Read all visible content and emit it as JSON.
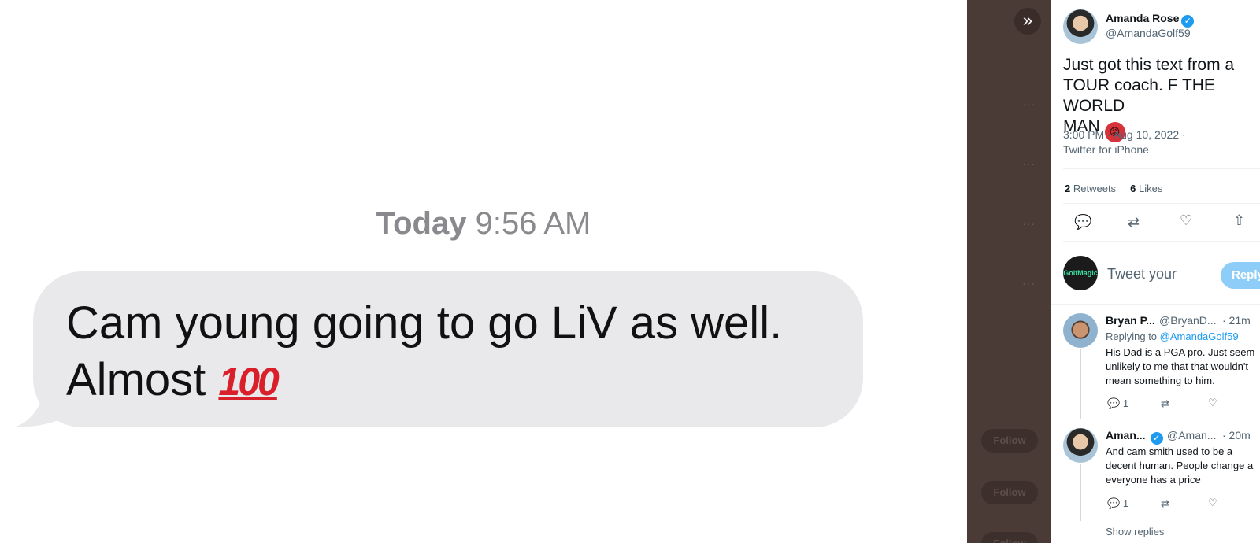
{
  "message": {
    "time_day": "Today",
    "time_clock": "9:56 AM",
    "line1": "Cam young going to go LiV as well.",
    "line2": "Almost",
    "emoji": "100"
  },
  "backdrop": {
    "collapse_icon": "»",
    "dots": "···",
    "follow_label": "Follow"
  },
  "tweet": {
    "author_name": "Amanda Rose",
    "author_handle": "@AmandaGolf59",
    "text_line1": "Just got this text from a",
    "text_line2": "TOUR coach. F THE WORLD",
    "text_line3": "MAN",
    "angry_emoji": "😡",
    "timestamp": "3:00 PM · Aug 10, 2022 ·",
    "source": "Twitter for iPhone",
    "retweets_count": "2",
    "retweets_label": "Retweets",
    "likes_count": "6",
    "likes_label": "Likes",
    "icons": {
      "reply": "💬",
      "retweet": "⇄",
      "like": "♡",
      "share": "⇧"
    }
  },
  "composer": {
    "avatar_label": "GolfMagic",
    "placeholder": "Tweet your",
    "reply_button": "Reply"
  },
  "replies": [
    {
      "name": "Bryan P...",
      "handle": "@BryanD...",
      "time": "· 21m",
      "replying_to_label": "Replying to",
      "replying_to_handle": "@AmandaGolf59",
      "line1": "His Dad is a PGA pro.  Just seem",
      "line2": "unlikely to me that that wouldn't",
      "line3": "mean something to him.",
      "reply_count": "1"
    },
    {
      "name": "Aman...",
      "handle": "@Aman...",
      "time": "· 20m",
      "line1": "And cam smith used to be a",
      "line2": "decent human. People change a",
      "line3": "everyone has a price",
      "reply_count": "1"
    }
  ],
  "show_replies": "Show replies"
}
